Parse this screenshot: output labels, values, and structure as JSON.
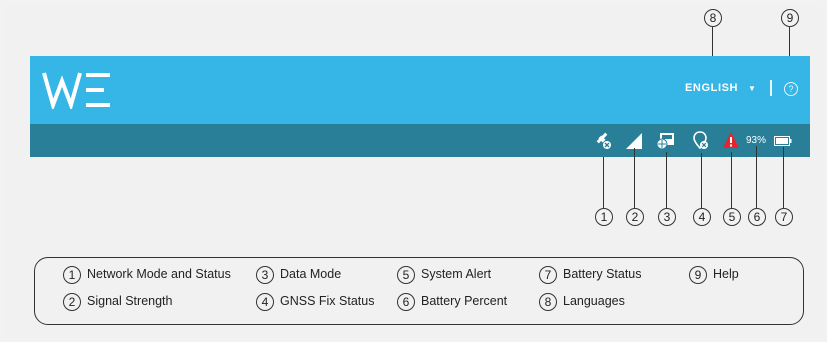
{
  "header": {
    "language_label": "ENGLISH",
    "language_caret": "▼",
    "help_glyph": "?",
    "accent_color": "#35b6e6"
  },
  "statusbar": {
    "background_color": "#2a7f98",
    "battery_percent_text": "93%",
    "icons": [
      "network-mode-icon",
      "signal-strength-icon",
      "data-mode-icon",
      "gnss-fix-icon",
      "system-alert-icon",
      "battery-icon"
    ]
  },
  "callouts": {
    "c1": "1",
    "c2": "2",
    "c3": "3",
    "c4": "4",
    "c5": "5",
    "c6": "6",
    "c7": "7",
    "c8": "8",
    "c9": "9"
  },
  "legend": {
    "items": [
      {
        "num": "1",
        "label": "Network Mode and Status"
      },
      {
        "num": "2",
        "label": "Signal Strength"
      },
      {
        "num": "3",
        "label": "Data Mode"
      },
      {
        "num": "4",
        "label": "GNSS Fix Status"
      },
      {
        "num": "5",
        "label": "System Alert"
      },
      {
        "num": "6",
        "label": "Battery Percent"
      },
      {
        "num": "7",
        "label": "Battery Status"
      },
      {
        "num": "8",
        "label": "Languages"
      },
      {
        "num": "9",
        "label": "Help"
      }
    ]
  }
}
